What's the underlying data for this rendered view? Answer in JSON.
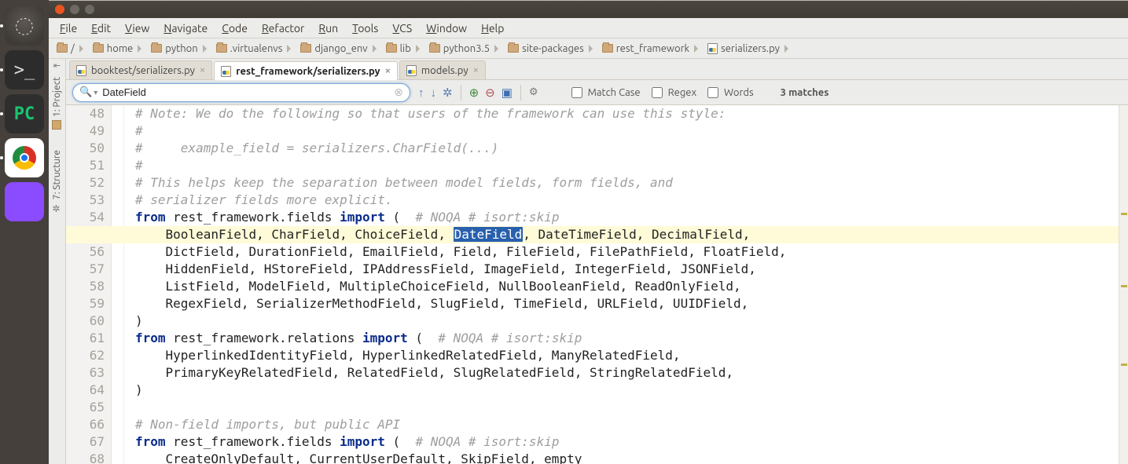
{
  "launcher": {
    "items": [
      {
        "name": "dash",
        "glyph": "◌"
      },
      {
        "name": "terminal",
        "glyph": ">_"
      },
      {
        "name": "pycharm",
        "glyph": "PC"
      },
      {
        "name": "chrome",
        "glyph": ""
      },
      {
        "name": "app",
        "glyph": ""
      }
    ]
  },
  "menu": [
    "File",
    "Edit",
    "View",
    "Navigate",
    "Code",
    "Refactor",
    "Run",
    "Tools",
    "VCS",
    "Window",
    "Help"
  ],
  "breadcrumb": [
    {
      "t": "/",
      "icon": "folder"
    },
    {
      "t": "home",
      "icon": "folder"
    },
    {
      "t": "python",
      "icon": "folder"
    },
    {
      "t": ".virtualenvs",
      "icon": "folder"
    },
    {
      "t": "django_env",
      "icon": "folder"
    },
    {
      "t": "lib",
      "icon": "folder"
    },
    {
      "t": "python3.5",
      "icon": "folder"
    },
    {
      "t": "site-packages",
      "icon": "folder"
    },
    {
      "t": "rest_framework",
      "icon": "folder"
    },
    {
      "t": "serializers.py",
      "icon": "pyfile"
    }
  ],
  "side_tools": {
    "top": {
      "label": "1: Project"
    },
    "bottom": {
      "label": "7: Structure"
    }
  },
  "tabs": [
    {
      "label": "booktest/serializers.py",
      "active": false
    },
    {
      "label": "rest_framework/serializers.py",
      "active": true
    },
    {
      "label": "models.py",
      "active": false
    }
  ],
  "find": {
    "value": "DateField",
    "match_case": "Match Case",
    "regex": "Regex",
    "words": "Words",
    "result": "3 matches"
  },
  "code": {
    "first_line": 48,
    "lines": [
      {
        "type": "comment",
        "text": "# Note: We do the following so that users of the framework can use this style:"
      },
      {
        "type": "comment",
        "text": "#"
      },
      {
        "type": "comment",
        "text": "#     example_field = serializers.CharField(...)"
      },
      {
        "type": "comment",
        "text": "#"
      },
      {
        "type": "comment",
        "text": "# This helps keep the separation between model fields, form fields, and"
      },
      {
        "type": "comment",
        "text": "# serializer fields more explicit."
      },
      {
        "type": "import",
        "kw1": "from",
        "mod": "rest_framework.fields",
        "kw2": "import",
        "tail": " (  ",
        "noqa": "# NOQA # isort:skip"
      },
      {
        "type": "fields",
        "hl": true,
        "items": [
          "BooleanField",
          "CharField",
          "ChoiceField",
          "DateField",
          "DateTimeField",
          "DecimalField"
        ],
        "select": "DateField"
      },
      {
        "type": "fields",
        "items": [
          "DictField",
          "DurationField",
          "EmailField",
          "Field",
          "FileField",
          "FilePathField",
          "FloatField"
        ]
      },
      {
        "type": "fields",
        "items": [
          "HiddenField",
          "HStoreField",
          "IPAddressField",
          "ImageField",
          "IntegerField",
          "JSONField"
        ]
      },
      {
        "type": "fields",
        "items": [
          "ListField",
          "ModelField",
          "MultipleChoiceField",
          "NullBooleanField",
          "ReadOnlyField"
        ]
      },
      {
        "type": "fields",
        "items": [
          "RegexField",
          "SerializerMethodField",
          "SlugField",
          "TimeField",
          "URLField",
          "UUIDField"
        ]
      },
      {
        "type": "plain",
        "text": ")"
      },
      {
        "type": "import",
        "kw1": "from",
        "mod": "rest_framework.relations",
        "kw2": "import",
        "tail": " (  ",
        "noqa": "# NOQA # isort:skip"
      },
      {
        "type": "fields",
        "items": [
          "HyperlinkedIdentityField",
          "HyperlinkedRelatedField",
          "ManyRelatedField"
        ]
      },
      {
        "type": "fields",
        "items": [
          "PrimaryKeyRelatedField",
          "RelatedField",
          "SlugRelatedField",
          "StringRelatedField"
        ]
      },
      {
        "type": "plain",
        "text": ")"
      },
      {
        "type": "blank"
      },
      {
        "type": "comment",
        "text": "# Non-field imports, but public API"
      },
      {
        "type": "import",
        "kw1": "from",
        "mod": "rest_framework.fields",
        "kw2": "import",
        "tail": " (  ",
        "noqa": "# NOQA # isort:skip"
      },
      {
        "type": "fields-open",
        "items": [
          "CreateOnlyDefault",
          "CurrentUserDefault",
          "SkipField",
          "empty"
        ]
      }
    ]
  }
}
